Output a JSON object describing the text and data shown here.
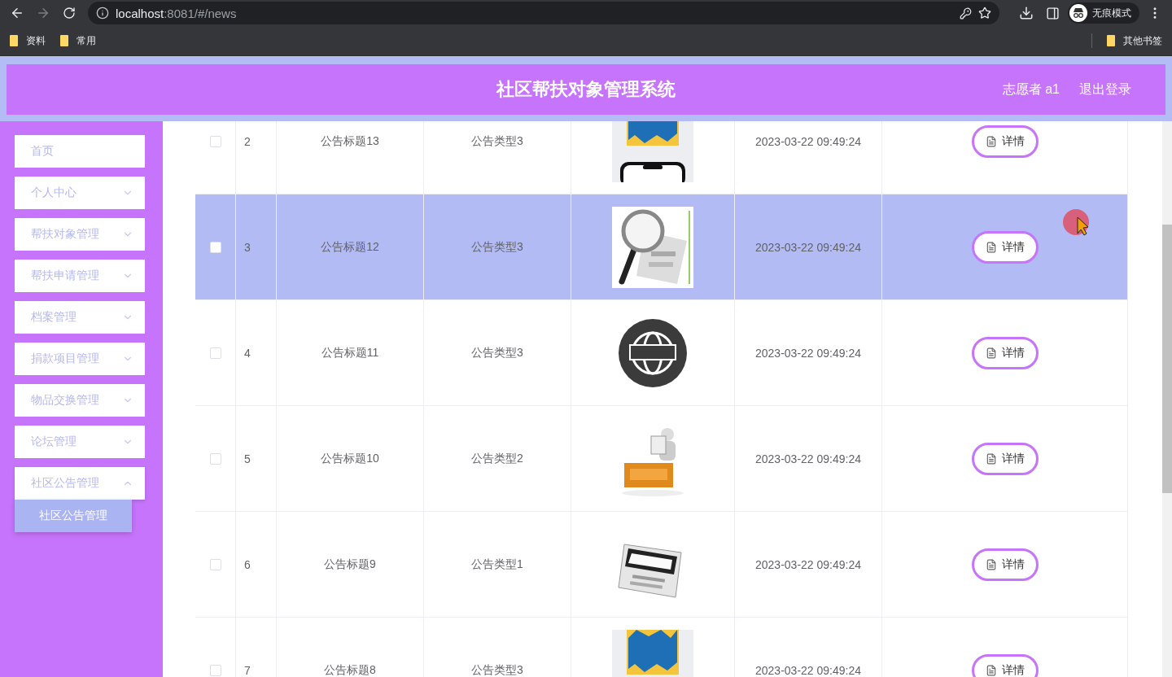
{
  "browser": {
    "nav": [
      {
        "kind": "back",
        "disabled": false
      },
      {
        "kind": "forward",
        "disabled": true
      },
      {
        "kind": "reload",
        "disabled": false
      }
    ],
    "url": {
      "host": "localhost",
      "path": ":8081/#/news"
    },
    "profile": "无痕模式",
    "bookmarks": [
      "资料",
      "常用"
    ],
    "other_bookmarks": "其他书签"
  },
  "header": {
    "title": "社区帮扶对象管理系统",
    "user": "志愿者 a1",
    "logout": "退出登录"
  },
  "sidebar": {
    "items": [
      {
        "label": "首页",
        "kind": "link",
        "expanded": false
      },
      {
        "label": "个人中心",
        "kind": "menu",
        "expanded": false
      },
      {
        "label": "帮扶对象管理",
        "kind": "menu",
        "expanded": false
      },
      {
        "label": "帮扶申请管理",
        "kind": "menu",
        "expanded": false
      },
      {
        "label": "档案管理",
        "kind": "menu",
        "expanded": false
      },
      {
        "label": "捐款项目管理",
        "kind": "menu",
        "expanded": false
      },
      {
        "label": "物品交换管理",
        "kind": "menu",
        "expanded": false
      },
      {
        "label": "论坛管理",
        "kind": "menu",
        "expanded": false
      },
      {
        "label": "社区公告管理",
        "kind": "menu",
        "expanded": true,
        "children": [
          {
            "label": "社区公告管理",
            "selected": true
          }
        ]
      }
    ]
  },
  "table": {
    "rows": [
      {
        "index": "2",
        "title": "公告标题13",
        "type": "公告类型3",
        "time": "2023-03-22 09:49:24",
        "action": "详情",
        "checked": false,
        "selected": false
      },
      {
        "index": "3",
        "title": "公告标题12",
        "type": "公告类型3",
        "time": "2023-03-22 09:49:24",
        "action": "详情",
        "checked": false,
        "selected": true
      },
      {
        "index": "4",
        "title": "公告标题11",
        "type": "公告类型3",
        "time": "2023-03-22 09:49:24",
        "action": "详情",
        "checked": false,
        "selected": false
      },
      {
        "index": "5",
        "title": "公告标题10",
        "type": "公告类型2",
        "time": "2023-03-22 09:49:24",
        "action": "详情",
        "checked": false,
        "selected": false
      },
      {
        "index": "6",
        "title": "公告标题9",
        "type": "公告类型1",
        "time": "2023-03-22 09:49:24",
        "action": "详情",
        "checked": false,
        "selected": false
      },
      {
        "index": "7",
        "title": "公告标题8",
        "type": "公告类型3",
        "time": "2023-03-22 09:49:24",
        "action": "详情",
        "checked": false,
        "selected": false
      }
    ]
  }
}
